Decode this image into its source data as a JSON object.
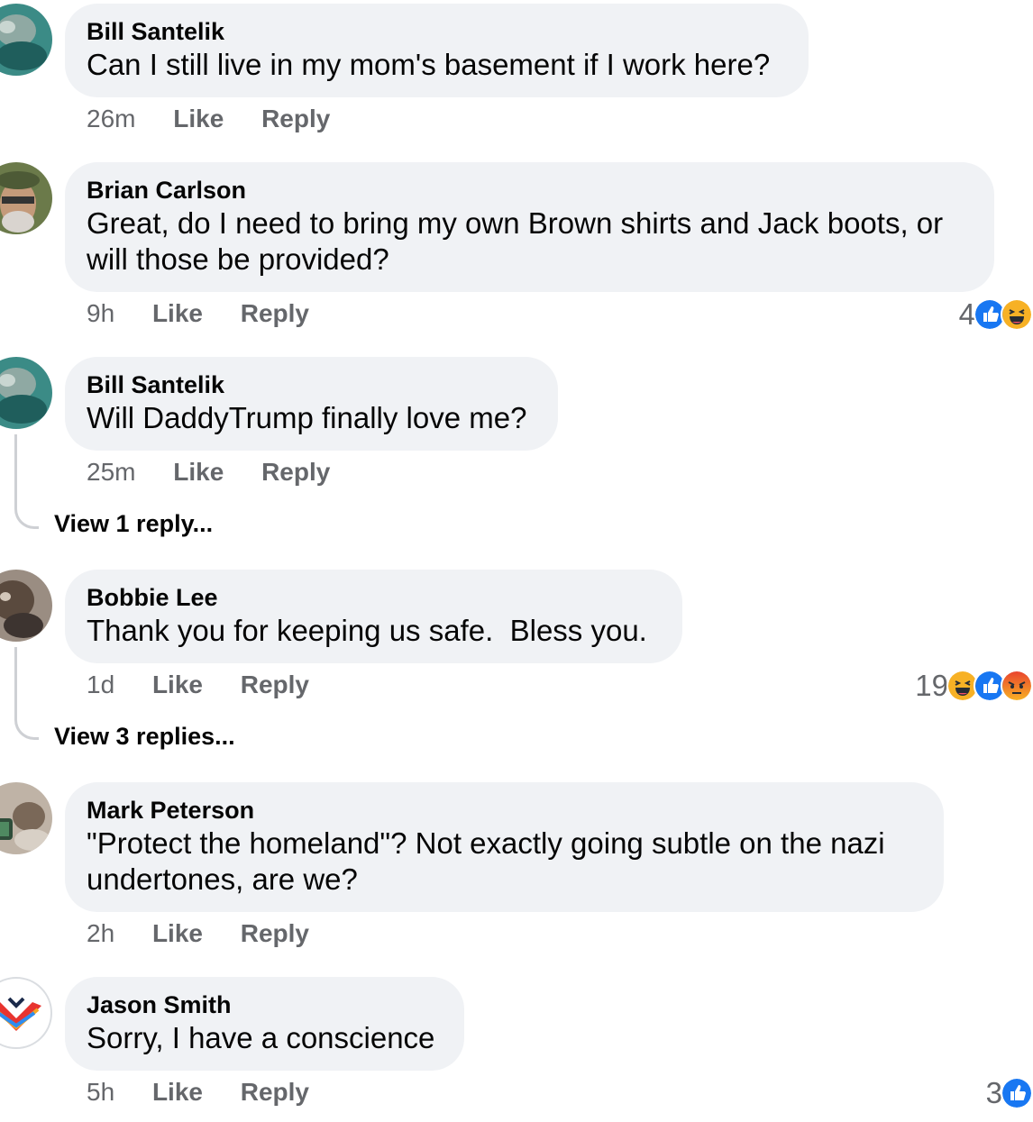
{
  "comments": [
    {
      "name": "Bill Santelik",
      "text": "Can I still live in my mom's basement if I work here?",
      "time": "26m",
      "like": "Like",
      "reply": "Reply"
    },
    {
      "name": "Brian Carlson",
      "text_line1": "Great, do I need to bring my own Brown shirts and Jack boots, or",
      "text_line2": "will those be provided?",
      "time": "9h",
      "like": "Like",
      "reply": "Reply",
      "reaction_count": "4"
    },
    {
      "name": "Bill Santelik",
      "text": "Will DaddyTrump finally love me?",
      "time": "25m",
      "like": "Like",
      "reply": "Reply",
      "view_replies": "View 1 reply..."
    },
    {
      "name": "Bobbie Lee",
      "text": "Thank you for keeping us safe.  Bless you.",
      "time": "1d",
      "like": "Like",
      "reply": "Reply",
      "reaction_count": "19",
      "view_replies": "View 3 replies..."
    },
    {
      "name": "Mark Peterson",
      "text_line1": "\"Protect the homeland\"? Not exactly going subtle on the nazi",
      "text_line2": "undertones, are we?",
      "time": "2h",
      "like": "Like",
      "reply": "Reply"
    },
    {
      "name": "Jason Smith",
      "text": "Sorry, I have a conscience",
      "time": "5h",
      "like": "Like",
      "reply": "Reply",
      "reaction_count": "3"
    }
  ],
  "colors": {
    "bubble": "#f0f2f5",
    "secondary_text": "#65676b",
    "like_blue": "#1877f2",
    "haha_yellow": "#f7b125",
    "angry_red": "#e9710f"
  },
  "icons": {
    "like": "like-reaction-icon",
    "haha": "haha-reaction-icon",
    "angry": "angry-reaction-icon"
  }
}
